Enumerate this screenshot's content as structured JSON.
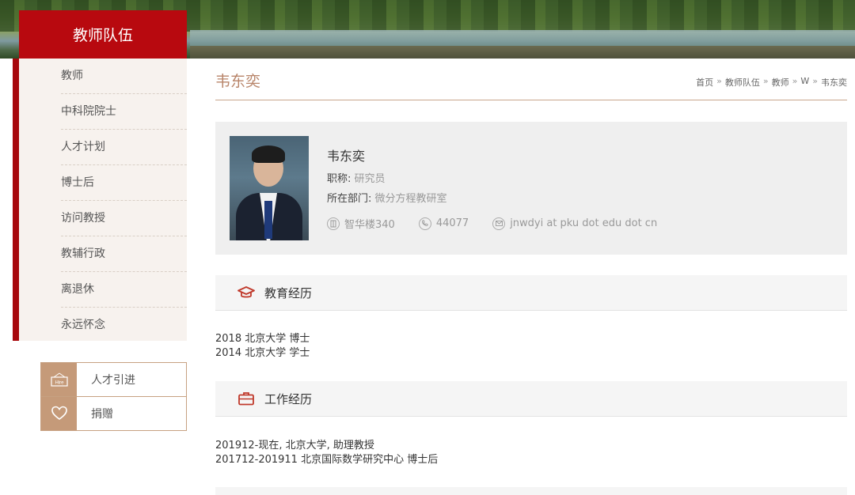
{
  "sidebar": {
    "title": "教师队伍",
    "items": [
      {
        "label": "教师"
      },
      {
        "label": "中科院院士"
      },
      {
        "label": "人才计划"
      },
      {
        "label": "博士后"
      },
      {
        "label": "访问教授"
      },
      {
        "label": "教辅行政"
      },
      {
        "label": "离退休"
      },
      {
        "label": "永远怀念"
      }
    ],
    "quick_links": [
      {
        "label": "人才引进",
        "icon": "hire-sign-icon",
        "icon_text": "Hire"
      },
      {
        "label": "捐赠",
        "icon": "heart-donate-icon"
      }
    ]
  },
  "page": {
    "title": "韦东奕",
    "breadcrumb": [
      "首页",
      "教师队伍",
      "教师",
      "W",
      "韦东奕"
    ],
    "breadcrumb_sep": "»"
  },
  "profile": {
    "name": "韦东奕",
    "title_label": "职称:",
    "title_value": "研究员",
    "dept_label": "所在部门:",
    "dept_value": "微分方程教研室",
    "office": "智华楼340",
    "phone": "44077",
    "email": "jnwdyi at pku dot edu dot cn"
  },
  "sections": {
    "education": {
      "title": "教育经历",
      "icon": "graduation-cap-icon",
      "entries": [
        "2018 北京大学 博士",
        "2014 北京大学 学士"
      ]
    },
    "work": {
      "title": "工作经历",
      "icon": "briefcase-icon",
      "entries": [
        "201912-现在, 北京大学, 助理教授",
        "201712-201911 北京国际数学研究中心 博士后"
      ]
    }
  },
  "colors": {
    "accent_red": "#b8090f",
    "title_tan": "#b8856a",
    "icon_red": "#c0392b"
  }
}
